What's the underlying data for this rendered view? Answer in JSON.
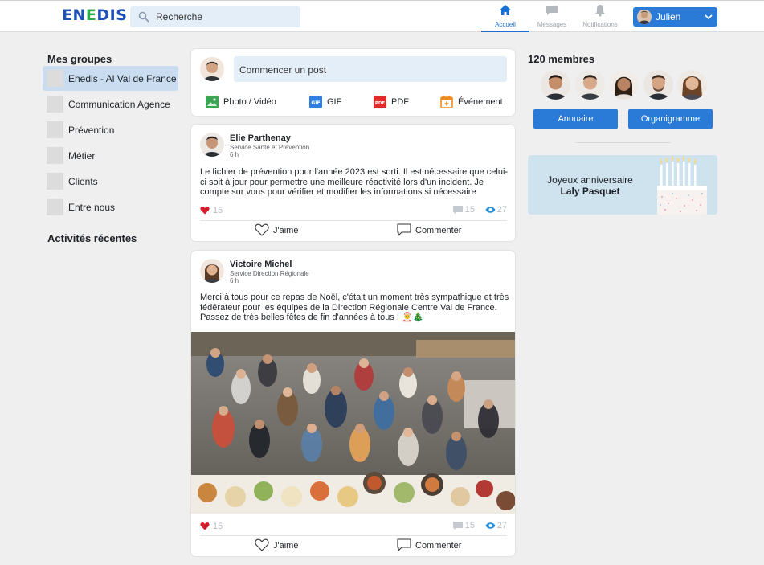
{
  "header": {
    "logo_prefix": "EN",
    "logo_highlight": "E",
    "logo_suffix": "DIS",
    "search_placeholder": "Recherche",
    "nav": [
      {
        "label": "Accueil",
        "icon": "home-icon",
        "active": true
      },
      {
        "label": "Messages",
        "icon": "message-icon",
        "active": false
      },
      {
        "label": "Notifications",
        "icon": "bell-icon",
        "active": false
      }
    ],
    "user_name": "Julien"
  },
  "sidebar": {
    "groups_title": "Mes groupes",
    "groups": [
      {
        "label": "Enedis - Al Val de France",
        "active": true
      },
      {
        "label": "Communication Agence",
        "active": false
      },
      {
        "label": "Prévention",
        "active": false
      },
      {
        "label": "Métier",
        "active": false
      },
      {
        "label": "Clients",
        "active": false
      },
      {
        "label": "Entre nous",
        "active": false
      }
    ],
    "activity_title": "Activités récentes"
  },
  "composer": {
    "placeholder": "Commencer un post",
    "actions": [
      {
        "label": "Photo / Vidéo",
        "icon": "image-icon",
        "color": "#3aa655"
      },
      {
        "label": "GIF",
        "icon": "gif-icon",
        "color": "#2f7fe0"
      },
      {
        "label": "PDF",
        "icon": "pdf-icon",
        "color": "#e02b2b"
      },
      {
        "label": "Événement",
        "icon": "calendar-icon",
        "color": "#f08a1c"
      }
    ]
  },
  "posts": [
    {
      "author": "Elie Parthenay",
      "service": "Service Santé et Prévention",
      "time": "6 h",
      "text": "Le fichier de prévention pour l'année 2023 est sorti. Il est nécessaire que celui-ci soit à jour pour permettre une meilleure réactivité lors d'un incident. Je compte sur vous pour vérifier et modifier les informations si nécessaire",
      "likes": "15",
      "comments": "15",
      "views": "27",
      "like_label": "J'aime",
      "comment_label": "Commenter"
    },
    {
      "author": "Victoire Michel",
      "service": "Service Direction Régionale",
      "time": "6 h",
      "text": "Merci à tous pour ce repas de Noël, c'était un moment très sympathique et très fédérateur pour les équipes de la Direction Régionale Centre Val de France. Passez de très belles fêtes de fin d'années à tous ! 🤶🎄",
      "likes": "15",
      "comments": "15",
      "views": "27",
      "like_label": "J'aime",
      "comment_label": "Commenter"
    }
  ],
  "members": {
    "title": "120 membres",
    "directory_label": "Annuaire",
    "org_label": "Organigramme"
  },
  "birthday": {
    "line1": "Joyeux anniversaire",
    "name": "Laly Pasquet"
  },
  "colors": {
    "primary": "#2a7ad8",
    "active_nav": "#1c6fd0",
    "heart": "#d81b2c",
    "eye": "#2a8fd8",
    "logo_blue": "#1f50b6",
    "logo_green": "#2aae4a"
  }
}
